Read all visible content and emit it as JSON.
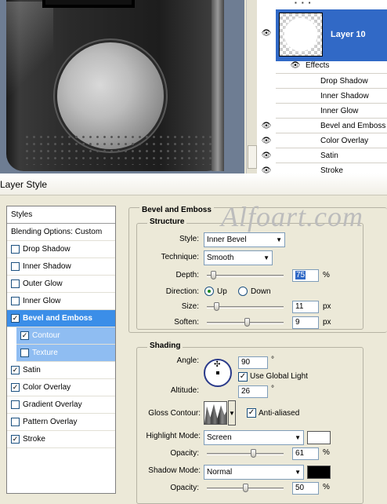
{
  "layers_panel": {
    "layer_name": "Layer 10",
    "effects_label": "Effects",
    "effects": [
      {
        "label": "Drop Shadow",
        "visible": false
      },
      {
        "label": "Inner Shadow",
        "visible": false
      },
      {
        "label": "Inner Glow",
        "visible": false
      },
      {
        "label": "Bevel and Emboss",
        "visible": true
      },
      {
        "label": "Color Overlay",
        "visible": true
      },
      {
        "label": "Satin",
        "visible": true
      },
      {
        "label": "Stroke",
        "visible": true
      }
    ]
  },
  "dialog": {
    "title": "Layer Style",
    "watermark": "Alfoart.com",
    "styles_list": {
      "header": "Styles",
      "blending_options": "Blending Options: Custom",
      "items": [
        {
          "label": "Drop Shadow",
          "checked": false,
          "state": "normal"
        },
        {
          "label": "Inner Shadow",
          "checked": false,
          "state": "normal"
        },
        {
          "label": "Outer Glow",
          "checked": false,
          "state": "normal"
        },
        {
          "label": "Inner Glow",
          "checked": false,
          "state": "normal"
        },
        {
          "label": "Bevel and Emboss",
          "checked": true,
          "state": "selected"
        },
        {
          "label": "Contour",
          "checked": true,
          "state": "sub"
        },
        {
          "label": "Texture",
          "checked": false,
          "state": "sub"
        },
        {
          "label": "Satin",
          "checked": true,
          "state": "normal"
        },
        {
          "label": "Color Overlay",
          "checked": true,
          "state": "normal"
        },
        {
          "label": "Gradient Overlay",
          "checked": false,
          "state": "normal"
        },
        {
          "label": "Pattern Overlay",
          "checked": false,
          "state": "normal"
        },
        {
          "label": "Stroke",
          "checked": true,
          "state": "normal"
        }
      ]
    },
    "bevel": {
      "section_title": "Bevel and Emboss",
      "structure_title": "Structure",
      "style_label": "Style:",
      "style_value": "Inner Bevel",
      "technique_label": "Technique:",
      "technique_value": "Smooth",
      "depth_label": "Depth:",
      "depth_value": "75",
      "depth_unit": "%",
      "depth_slider": 0.05,
      "direction_label": "Direction:",
      "direction_up": "Up",
      "direction_down": "Down",
      "size_label": "Size:",
      "size_value": "11",
      "size_unit": "px",
      "size_slider": 0.1,
      "soften_label": "Soften:",
      "soften_value": "9",
      "soften_unit": "px",
      "soften_slider": 0.52
    },
    "shading": {
      "title": "Shading",
      "angle_label": "Angle:",
      "angle_value": "90",
      "angle_unit": "°",
      "global_light_label": "Use Global Light",
      "altitude_label": "Altitude:",
      "altitude_value": "26",
      "altitude_unit": "°",
      "gloss_label": "Gloss Contour:",
      "anti_aliased_label": "Anti-aliased",
      "highlight_mode_label": "Highlight Mode:",
      "highlight_mode_value": "Screen",
      "highlight_color": "#ffffff",
      "highlight_opacity_label": "Opacity:",
      "highlight_opacity_value": "61",
      "highlight_opacity_unit": "%",
      "highlight_opacity_slider": 0.61,
      "shadow_mode_label": "Shadow Mode:",
      "shadow_mode_value": "Normal",
      "shadow_color": "#000000",
      "shadow_opacity_label": "Opacity:",
      "shadow_opacity_value": "50",
      "shadow_opacity_unit": "%",
      "shadow_opacity_slider": 0.5
    }
  }
}
